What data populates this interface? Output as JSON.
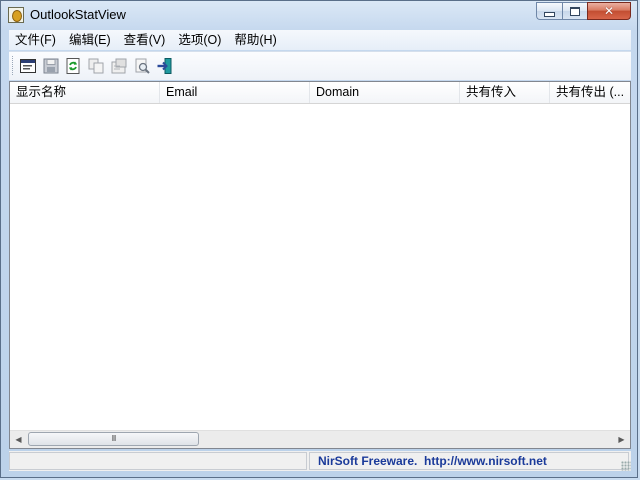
{
  "window": {
    "title": "OutlookStatView"
  },
  "menu": [
    {
      "label": "文件(F)"
    },
    {
      "label": "编辑(E)"
    },
    {
      "label": "查看(V)"
    },
    {
      "label": "选项(O)"
    },
    {
      "label": "帮助(H)"
    }
  ],
  "toolbar": {
    "icons": [
      "html-report-icon",
      "save-icon",
      "refresh-icon",
      "copy-icon",
      "properties-icon",
      "find-icon",
      "exit-icon"
    ]
  },
  "columns": [
    {
      "label": "显示名称"
    },
    {
      "label": "Email"
    },
    {
      "label": "Domain"
    },
    {
      "label": "共有传入"
    },
    {
      "label": "共有传出 (..."
    }
  ],
  "scrollbar": {
    "thumb_glyph": "III",
    "left_arrow": "◀",
    "right_arrow": "▶"
  },
  "status": {
    "left_text": "",
    "right_text": "NirSoft Freeware.  http://www.nirsoft.net"
  },
  "colors": {
    "status_link": "#1a3a9a",
    "close_button": "#c24e32"
  }
}
